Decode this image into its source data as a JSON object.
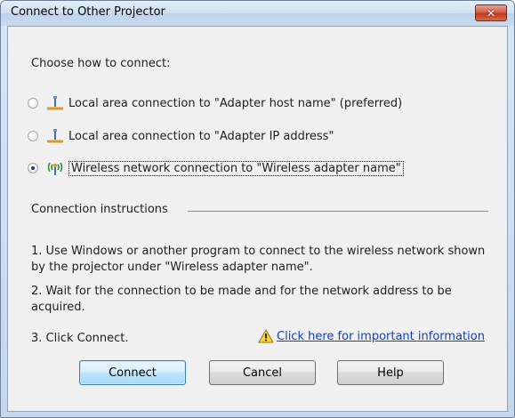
{
  "window": {
    "title": "Connect to Other Projector",
    "close_symbol": "✕"
  },
  "heading": "Choose how to connect:",
  "options": [
    {
      "label": "Local area connection to \"Adapter host name\" (preferred)",
      "icon": "wired-network-icon",
      "selected": false
    },
    {
      "label": "Local area connection to \"Adapter IP address\"",
      "icon": "wired-network-icon",
      "selected": false
    },
    {
      "label": "Wireless network connection to \"Wireless adapter name\"",
      "icon": "wireless-network-icon",
      "selected": true
    }
  ],
  "instructions": {
    "group_title": "Connection instructions",
    "step1": "1. Use Windows or another program to connect to the wireless network shown by the projector under \"Wireless adapter name\".",
    "step2": "2. Wait for the connection to be made and for the network address to be acquired.",
    "step3": "3. Click Connect.",
    "important_link": "Click here for important information",
    "warning_icon": "warning-icon"
  },
  "buttons": {
    "connect": "Connect",
    "cancel": "Cancel",
    "help": "Help"
  },
  "colors": {
    "link": "#0b42c8",
    "close": "#c0391e",
    "default_button": "#a7d9f5"
  }
}
